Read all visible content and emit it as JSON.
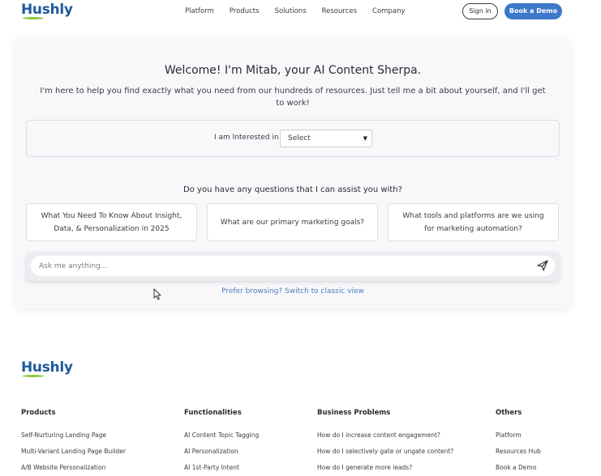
{
  "header": {
    "logo_text": "Hushly",
    "nav": [
      "Platform",
      "Products",
      "Solutions",
      "Resources",
      "Company"
    ],
    "signin_label": "Sign in",
    "demo_label": "Book a Demo"
  },
  "main": {
    "welcome": "Welcome! I'm Mitab, your AI Content Sherpa.",
    "intro": "I'm here to help you find exactly what you need from our hundreds of resources. Just tell me a bit about yourself, and I'll get to work!",
    "interest_label": "I am Interested in",
    "interest_select": "Select",
    "questions_heading": "Do you have any questions that I can assist you with?",
    "suggestions": [
      "What You Need To Know About Insight, Data, & Personalization in 2025",
      "What are our primary marketing goals?",
      "What tools and platforms are we using for marketing automation?"
    ],
    "ask_placeholder": "Ask me anything...",
    "classic_view_link": "Prefer browsing? Switch to classic view"
  },
  "footer": {
    "logo_text": "Hushly",
    "columns": [
      {
        "title": "Products",
        "links": [
          "Self-Nurturing Landing Page",
          "Multi-Variant Landing Page Builder",
          "A/B Website Personalization"
        ]
      },
      {
        "title": "Functionalities",
        "links": [
          "AI Content Topic Tagging",
          "AI Personalization",
          "AI 1st-Party Intent"
        ]
      },
      {
        "title": "Business Problems",
        "links": [
          "How do I increase content engagement?",
          "How do I selectively gate or ungate content?",
          "How do I generate more leads?"
        ]
      },
      {
        "title": "Others",
        "links": [
          "Platform",
          "Resources Hub",
          "Book a Demo"
        ]
      }
    ]
  },
  "colors": {
    "brand_blue": "#1e5a9c",
    "accent_green": "#8cc63f",
    "button_blue": "#3d78c9",
    "link_blue": "#4a7fbf"
  }
}
